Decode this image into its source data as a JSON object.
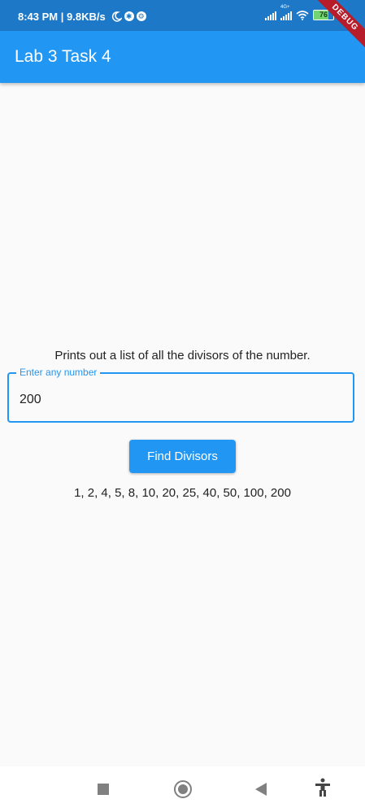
{
  "status_bar": {
    "time_speed": "8:43 PM | 9.8KB/s",
    "network": "4G+",
    "battery": "76",
    "icons": [
      "moon-icon",
      "app-notification-icon",
      "settings-notification-icon",
      "signal-icon",
      "signal-4g-icon",
      "wifi-icon",
      "battery-icon"
    ]
  },
  "debug_banner": "DEBUG",
  "app_bar": {
    "title": "Lab 3 Task 4"
  },
  "main": {
    "description": "Prints out a list of all the divisors of the number.",
    "input": {
      "label": "Enter any number",
      "value": "200"
    },
    "button_label": "Find Divisors",
    "result": "1, 2, 4, 5, 8, 10, 20, 25, 40, 50, 100, 200"
  },
  "nav_bar": {
    "icons": [
      "recents-icon",
      "home-icon",
      "back-icon",
      "accessibility-icon"
    ]
  },
  "colors": {
    "primary": "#2196f3",
    "status_bar": "#1e78c8",
    "debug": "#b71c2a",
    "background": "#fafafa"
  }
}
